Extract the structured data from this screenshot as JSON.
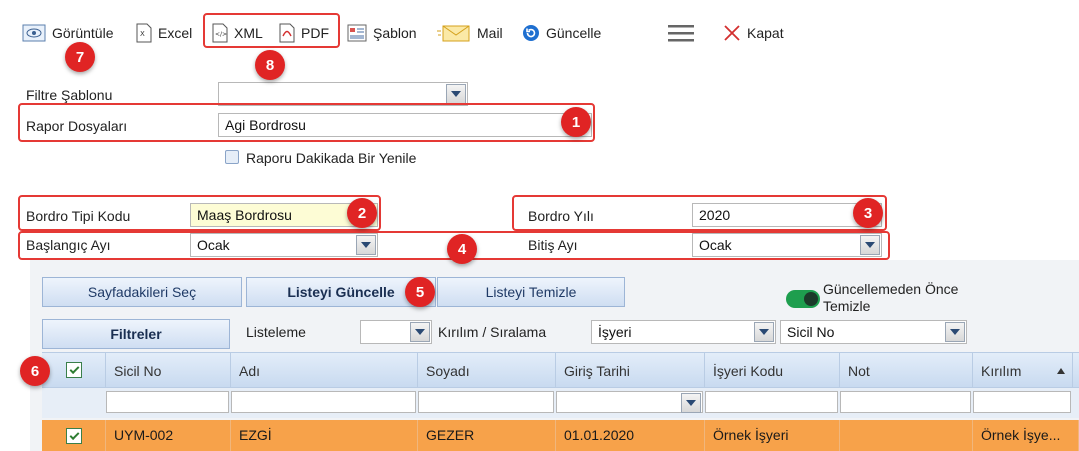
{
  "toolbar": {
    "view_label": "Görüntüle",
    "excel_label": "Excel",
    "xml_label": "XML",
    "pdf_label": "PDF",
    "template_label": "Şablon",
    "mail_label": "Mail",
    "refresh_label": "Güncelle",
    "close_label": "Kapat"
  },
  "badges": [
    "7",
    "8",
    "1",
    "2",
    "3",
    "4",
    "5",
    "6"
  ],
  "form": {
    "filter_template_label": "Filtre Şablonu",
    "filter_template_value": "",
    "report_files_label": "Rapor Dosyaları",
    "report_files_value": "Agi Bordrosu",
    "auto_refresh_label": "Raporu Dakikada Bir Yenile",
    "payroll_type_label": "Bordro Tipi Kodu",
    "payroll_type_value": "Maaş Bordrosu",
    "payroll_year_label": "Bordro Yılı",
    "payroll_year_value": "2020",
    "start_month_label": "Başlangıç Ayı",
    "start_month_value": "Ocak",
    "end_month_label": "Bitiş Ayı",
    "end_month_value": "Ocak"
  },
  "actions": {
    "select_page_label": "Sayfadakileri Seç",
    "update_list_label": "Listeyi Güncelle",
    "clear_list_label": "Listeyi Temizle",
    "clear_before_update_label_1": "Güncellemeden Önce",
    "clear_before_update_label_2": "Temizle",
    "filters_label": "Filtreler",
    "listing_label": "Listeleme",
    "listing_value": "",
    "breakdown_label": "Kırılım / Sıralama",
    "breakdown_value_1": "İşyeri",
    "breakdown_value_2": "Sicil No"
  },
  "grid": {
    "columns": [
      "Sicil No",
      "Adı",
      "Soyadı",
      "Giriş Tarihi",
      "İşyeri Kodu",
      "Not",
      "Kırılım"
    ],
    "rows": [
      [
        "UYM-002",
        "EZGİ",
        "GEZER",
        "01.01.2020",
        "Örnek İşyeri",
        "",
        "Örnek İşye..."
      ]
    ]
  },
  "colors": {
    "accent_red": "#e02424",
    "row_highlight": "#f7a24a",
    "toggle_on": "#1e9e4e"
  }
}
